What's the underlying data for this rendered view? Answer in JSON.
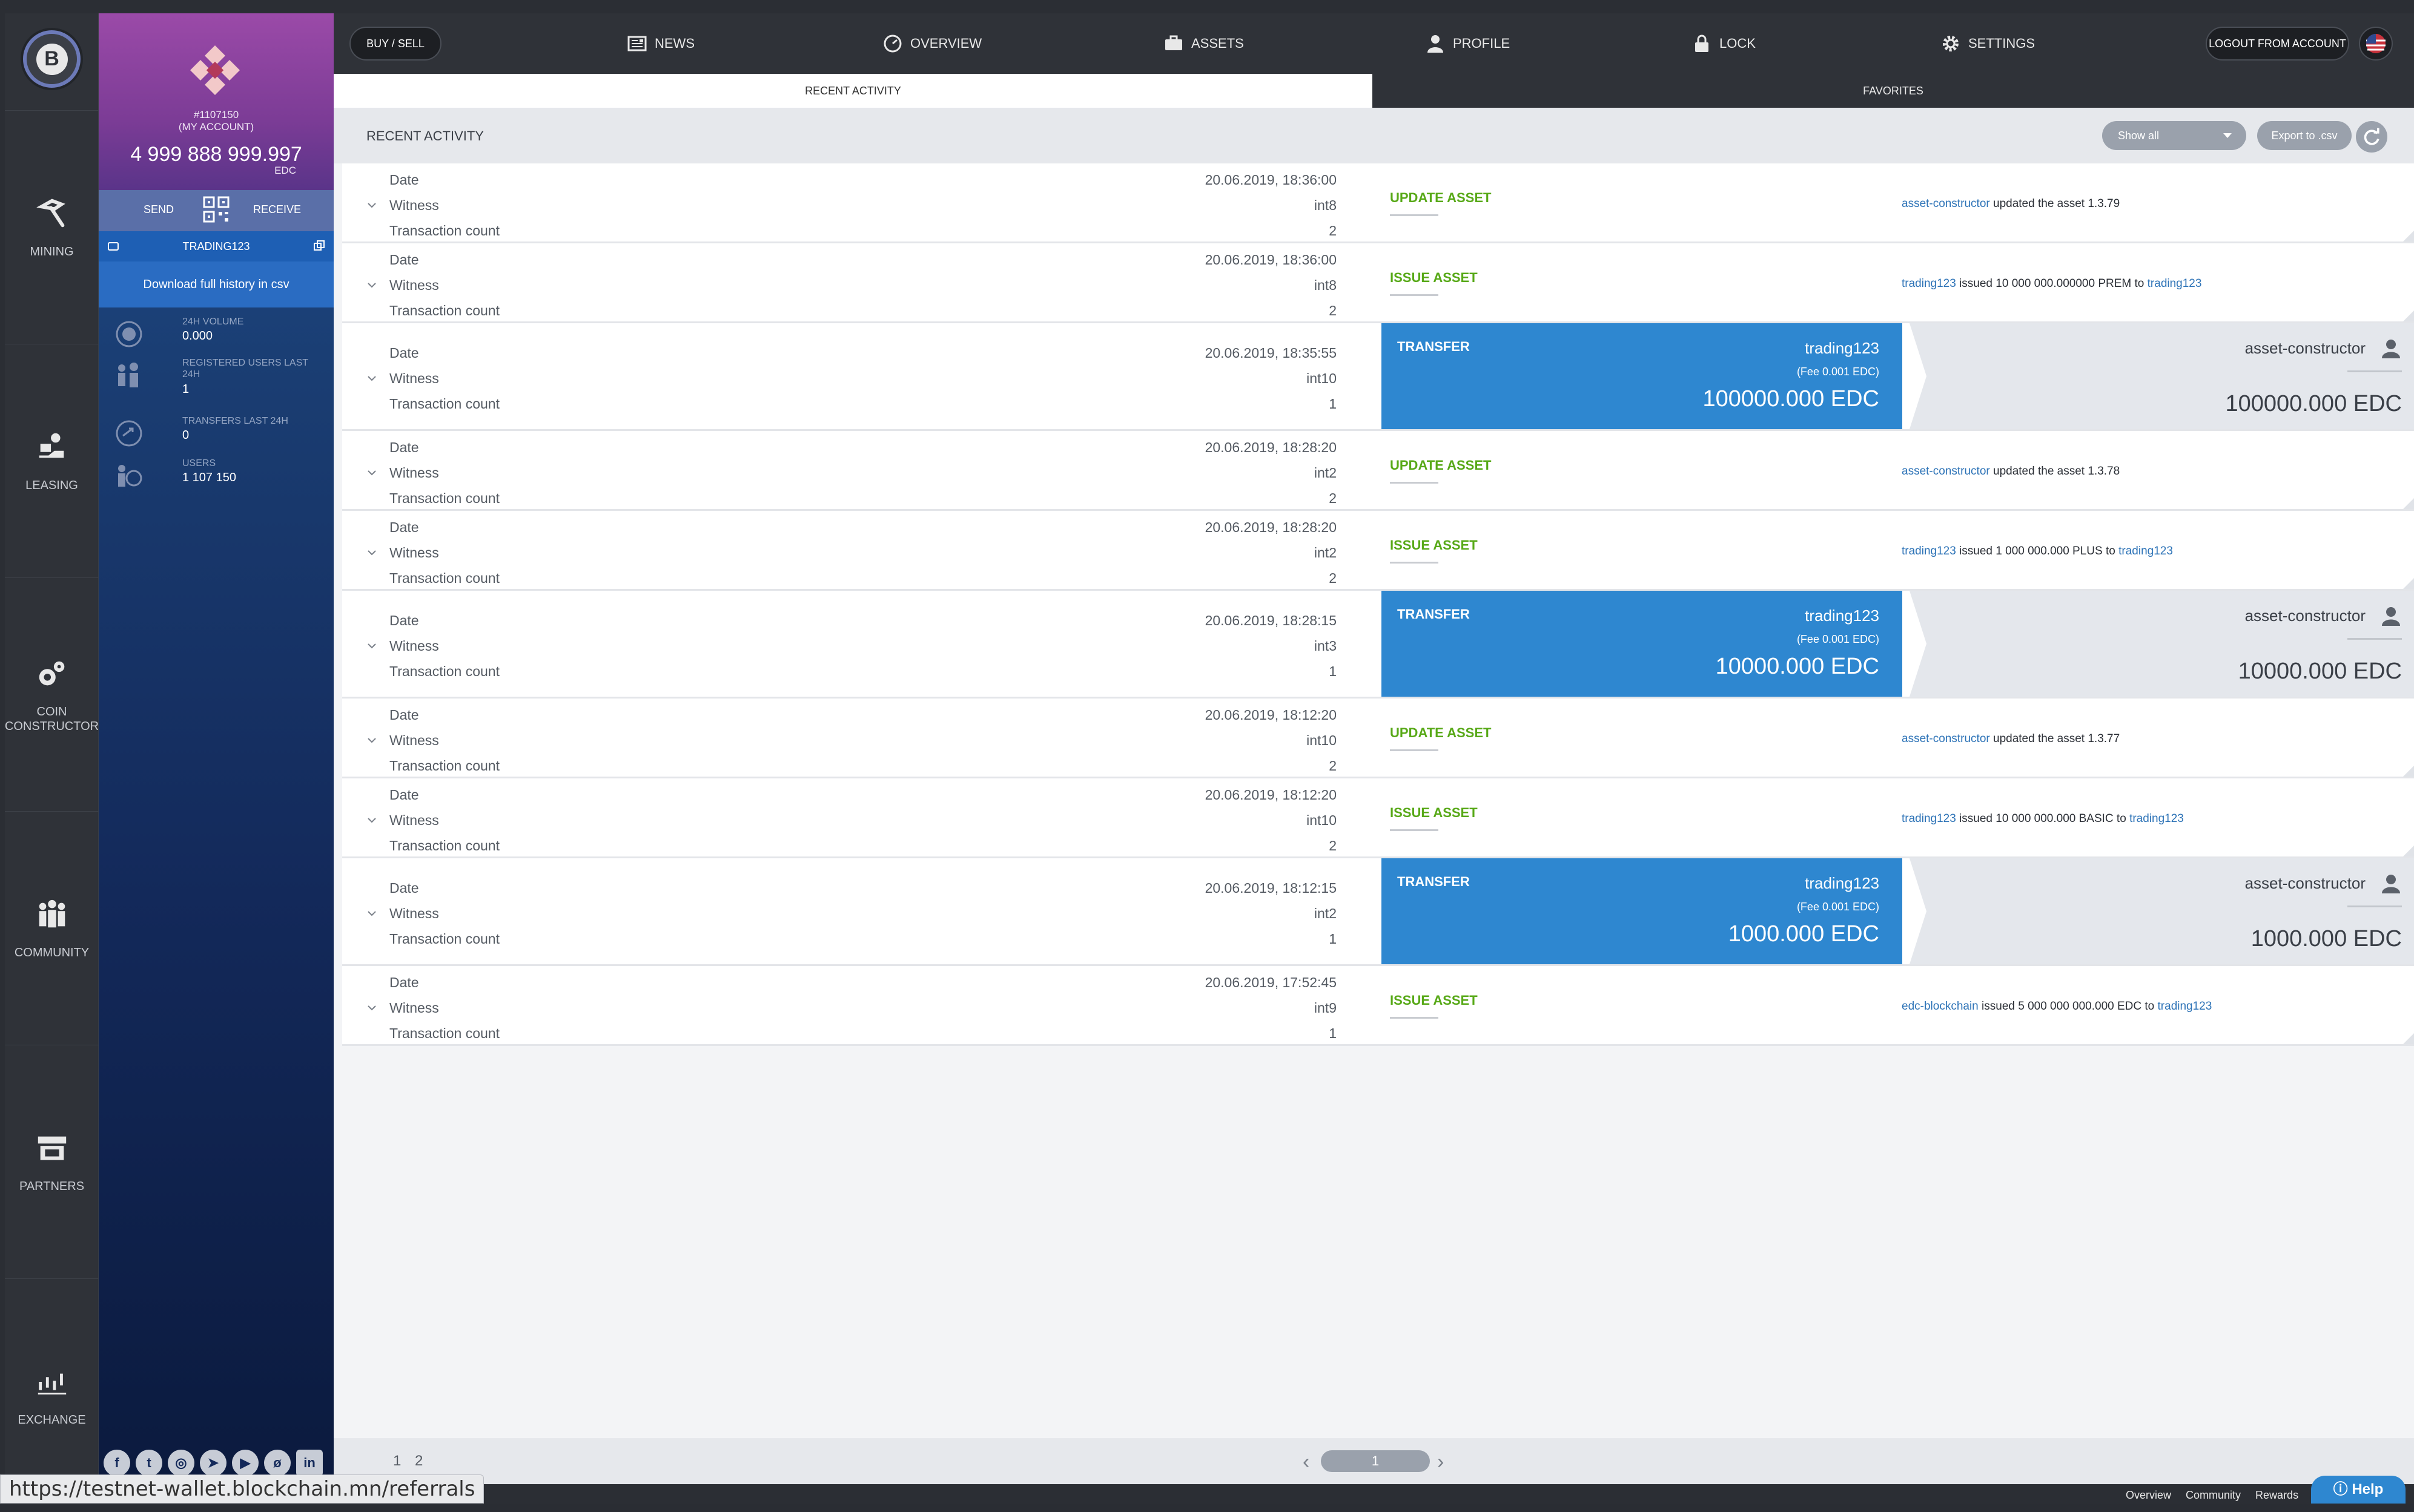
{
  "sidebar": {
    "items": [
      {
        "label": "MINING",
        "icon": "pickaxe-icon"
      },
      {
        "label": "LEASING",
        "icon": "leasing-icon"
      },
      {
        "label": "COIN CONSTRUCTOR",
        "icon": "coin-constructor-icon"
      },
      {
        "label": "COMMUNITY",
        "icon": "community-icon"
      },
      {
        "label": "PARTNERS",
        "icon": "store-icon"
      },
      {
        "label": "EXCHANGE",
        "icon": "exchange-chart-icon"
      }
    ]
  },
  "account": {
    "id": "#1107150",
    "label": "(MY ACCOUNT)",
    "balance": "4 999 888 999.997",
    "currency": "EDC",
    "send": "SEND",
    "receive": "RECEIVE",
    "trading": "TRADING123",
    "download": "Download full history in csv"
  },
  "stats": [
    {
      "label": "24H VOLUME",
      "value": "0.000"
    },
    {
      "label": "REGISTERED USERS LAST 24H",
      "value": "1"
    },
    {
      "label": "TRANSFERS LAST 24H",
      "value": "0"
    },
    {
      "label": "USERS",
      "value": "1 107 150"
    }
  ],
  "socials": [
    "f",
    "t",
    "◎",
    "➤",
    "▶",
    "ø",
    "in"
  ],
  "nav": {
    "buy_sell": "BUY / SELL",
    "news": "NEWS",
    "overview": "OVERVIEW",
    "assets": "ASSETS",
    "profile": "PROFILE",
    "lock": "LOCK",
    "settings": "SETTINGS",
    "logout": "LOGOUT FROM ACCOUNT"
  },
  "tabs": {
    "recent": "RECENT ACTIVITY",
    "favorites": "FAVORITES"
  },
  "activity": {
    "title": "RECENT ACTIVITY",
    "filter": "Show all",
    "export": "Export to .csv",
    "labels": {
      "date": "Date",
      "witness": "Witness",
      "count": "Transaction count"
    },
    "rows": [
      {
        "date": "20.06.2019, 18:36:00",
        "witness": "int8",
        "count": "2",
        "kind": "UPDATE ASSET",
        "a": "asset-constructor",
        "text": " updated the asset 1.3.79",
        "b": ""
      },
      {
        "date": "20.06.2019, 18:36:00",
        "witness": "int8",
        "count": "2",
        "kind": "ISSUE ASSET",
        "a": "trading123",
        "text": " issued 10 000 000.000000 PREM to ",
        "b": "trading123"
      },
      {
        "date": "20.06.2019, 18:35:55",
        "witness": "int10",
        "count": "1",
        "kind": "TRANSFER",
        "from": "trading123",
        "fee": "(Fee 0.001 EDC)",
        "amount": "100000.000 EDC",
        "to": "asset-constructor"
      },
      {
        "date": "20.06.2019, 18:28:20",
        "witness": "int2",
        "count": "2",
        "kind": "UPDATE ASSET",
        "a": "asset-constructor",
        "text": " updated the asset 1.3.78",
        "b": ""
      },
      {
        "date": "20.06.2019, 18:28:20",
        "witness": "int2",
        "count": "2",
        "kind": "ISSUE ASSET",
        "a": "trading123",
        "text": " issued 1 000 000.000 PLUS to ",
        "b": "trading123"
      },
      {
        "date": "20.06.2019, 18:28:15",
        "witness": "int3",
        "count": "1",
        "kind": "TRANSFER",
        "from": "trading123",
        "fee": "(Fee 0.001 EDC)",
        "amount": "10000.000 EDC",
        "to": "asset-constructor"
      },
      {
        "date": "20.06.2019, 18:12:20",
        "witness": "int10",
        "count": "2",
        "kind": "UPDATE ASSET",
        "a": "asset-constructor",
        "text": " updated the asset 1.3.77",
        "b": ""
      },
      {
        "date": "20.06.2019, 18:12:20",
        "witness": "int10",
        "count": "2",
        "kind": "ISSUE ASSET",
        "a": "trading123",
        "text": " issued 10 000 000.000 BASIC to ",
        "b": "trading123"
      },
      {
        "date": "20.06.2019, 18:12:15",
        "witness": "int2",
        "count": "1",
        "kind": "TRANSFER",
        "from": "trading123",
        "fee": "(Fee 0.001 EDC)",
        "amount": "1000.000 EDC",
        "to": "asset-constructor"
      },
      {
        "date": "20.06.2019, 17:52:45",
        "witness": "int9",
        "count": "1",
        "kind": "ISSUE ASSET",
        "a": "edc-blockchain",
        "text": " issued 5 000 000 000.000 EDC to ",
        "b": "trading123"
      }
    ]
  },
  "pager": {
    "pages": "1 2",
    "current": "1"
  },
  "status_url": "https://testnet-wallet.blockchain.mn/referrals",
  "footer": {
    "overview": "Overview",
    "community": "Community",
    "rewards": "Rewards",
    "help": "Help"
  },
  "colors": {
    "accent": "#2e87d0",
    "green": "#58a918",
    "link": "#2d73b7"
  }
}
